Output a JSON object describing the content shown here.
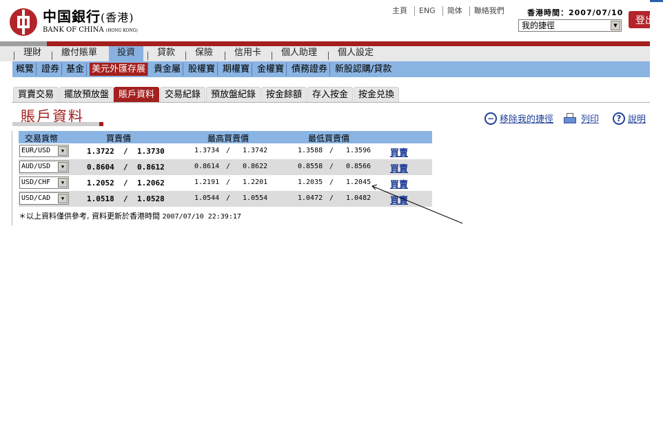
{
  "bank": {
    "name_cn": "中国銀行",
    "name_cn_suffix": "(香港)",
    "name_en": "BANK OF CHINA",
    "name_en_suffix": "(HONG KONG)"
  },
  "toplinks": [
    "主頁",
    "ENG",
    "简体",
    "聯絡我們"
  ],
  "hk_time_label": "香港時間：",
  "hk_time_value": "2007/07/10",
  "shortcut_select": "我的捷徑",
  "logout_label": "登出",
  "main_nav": [
    "理財",
    "繳付賬單",
    "投資",
    "貸款",
    "保險",
    "信用卡",
    "個人助理",
    "個人設定"
  ],
  "sub_nav": [
    "概覽",
    "證券",
    "基金",
    "美元外匯存展",
    "貴金屬",
    "股權寶",
    "期權寶",
    "金權寶",
    "債務證券",
    "新股認購/貸款"
  ],
  "tabs": [
    "買賣交易",
    "擺放預放盤",
    "賬戶資料",
    "交易紀錄",
    "預放盤紀錄",
    "按金餘額",
    "存入按金",
    "按金兑換"
  ],
  "page_title": "賬戶資料",
  "tools": {
    "remove_shortcut": "移除我的捷徑",
    "print": "列印",
    "help": "說明",
    "help_icon_glyph": "?",
    "remove_icon_glyph": "−"
  },
  "table": {
    "headers": {
      "currency": "交易貨幣",
      "price": "買賣價",
      "high": "最高買賣價",
      "low": "最低買賣價"
    },
    "separator": "/",
    "rows": [
      {
        "pair": "EUR/USD",
        "bid": "1.3722",
        "ask": "1.3730",
        "high_bid": "1.3734",
        "high_ask": "1.3742",
        "low_bid": "1.3588",
        "low_ask": "1.3596",
        "action": "買賣"
      },
      {
        "pair": "AUD/USD",
        "bid": "0.8604",
        "ask": "0.8612",
        "high_bid": "0.8614",
        "high_ask": "0.8622",
        "low_bid": "0.8558",
        "low_ask": "0.8566",
        "action": "買賣"
      },
      {
        "pair": "USD/CHF",
        "bid": "1.2052",
        "ask": "1.2062",
        "high_bid": "1.2191",
        "high_ask": "1.2201",
        "low_bid": "1.2035",
        "low_ask": "1.2045",
        "action": "買賣"
      },
      {
        "pair": "USD/CAD",
        "bid": "1.0518",
        "ask": "1.0528",
        "high_bid": "1.0544",
        "high_ask": "1.0554",
        "low_bid": "1.0472",
        "low_ask": "1.0482",
        "action": "買賣"
      }
    ]
  },
  "note_text": "＊以上資料僅供參考, 資料更新於香港時間",
  "note_timestamp": "2007/07/10 22:39:17",
  "colors": {
    "brand_red": "#a3201f",
    "nav_blue": "#8ab4e2",
    "link_blue": "#1f3f99"
  }
}
